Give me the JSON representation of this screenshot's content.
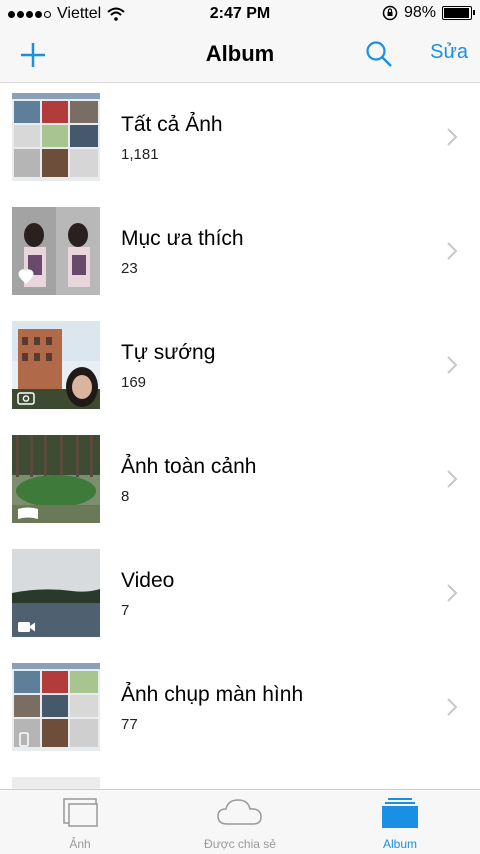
{
  "status": {
    "carrier": "Viettel",
    "time": "2:47 PM",
    "battery": "98%"
  },
  "nav": {
    "title": "Album",
    "edit_label": "Sửa"
  },
  "albums": [
    {
      "title": "Tất cả Ảnh",
      "count": "1,181"
    },
    {
      "title": "Mục ưa thích",
      "count": "23"
    },
    {
      "title": "Tự sướng",
      "count": "169"
    },
    {
      "title": "Ảnh toàn cảnh",
      "count": "8"
    },
    {
      "title": "Video",
      "count": "7"
    },
    {
      "title": "Ảnh chụp màn hình",
      "count": "77"
    }
  ],
  "tabs": [
    {
      "label": "Ảnh",
      "active": false
    },
    {
      "label": "Được chia sẻ",
      "active": false
    },
    {
      "label": "Album",
      "active": true
    }
  ],
  "colors": {
    "accent": "#1a8fe3",
    "bar_bg": "#f7f7f7",
    "chevron": "#c7c7cc"
  }
}
